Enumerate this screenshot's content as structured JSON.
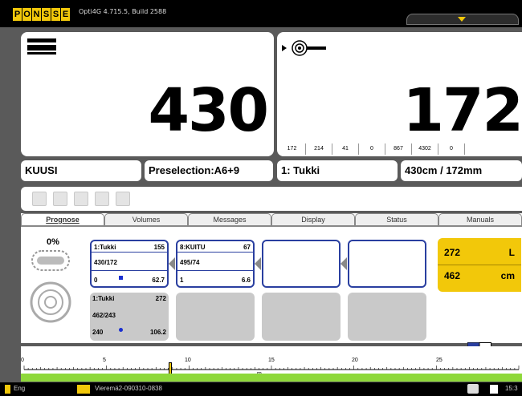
{
  "header": {
    "logo_letters": [
      "P",
      "O",
      "N",
      "S",
      "S",
      "E"
    ],
    "version": "Opti4G 4.715.5, Build 2588"
  },
  "main": {
    "left_value": "430",
    "right_value": "172",
    "counters": [
      "172",
      "214",
      "41",
      "0",
      "867",
      "4302",
      "0",
      ""
    ]
  },
  "info": {
    "species": "KUUSI",
    "preselection": "Preselection:A6+9",
    "product": "1: Tukki",
    "size": "430cm / 172mm"
  },
  "tabs": [
    {
      "label": "Prognose",
      "active": true
    },
    {
      "label": "Volumes",
      "active": false
    },
    {
      "label": "Messages",
      "active": false
    },
    {
      "label": "Display",
      "active": false
    },
    {
      "label": "Status",
      "active": false
    },
    {
      "label": "Manuals",
      "active": false
    }
  ],
  "prognose": {
    "percent": "0%",
    "card1": {
      "name": "1:Tukki",
      "count": "155",
      "dims": "430/172",
      "left": "0",
      "right": "62.7"
    },
    "card2": {
      "name": "8:KUITU",
      "count": "67",
      "dims": "495/74",
      "left": "1",
      "right": "6.6"
    },
    "card_gray": {
      "name": "1:Tukki",
      "count": "272",
      "dims": "462/243",
      "left": "240",
      "right": "106.2"
    },
    "yellow": {
      "v1": "272",
      "u1": "L",
      "v2": "462",
      "u2": "cm"
    }
  },
  "ruler": {
    "labels": [
      "0",
      "5",
      "10",
      "15",
      "20",
      "25"
    ],
    "sub_label": "m"
  },
  "status": {
    "language": "Eng",
    "file": "Vieremä2-090310-0838",
    "time": "15:3"
  },
  "colors": {
    "brand_yellow": "#f2c80a",
    "card_blue": "#2a3fa0",
    "green_bar": "#8ed83a"
  }
}
